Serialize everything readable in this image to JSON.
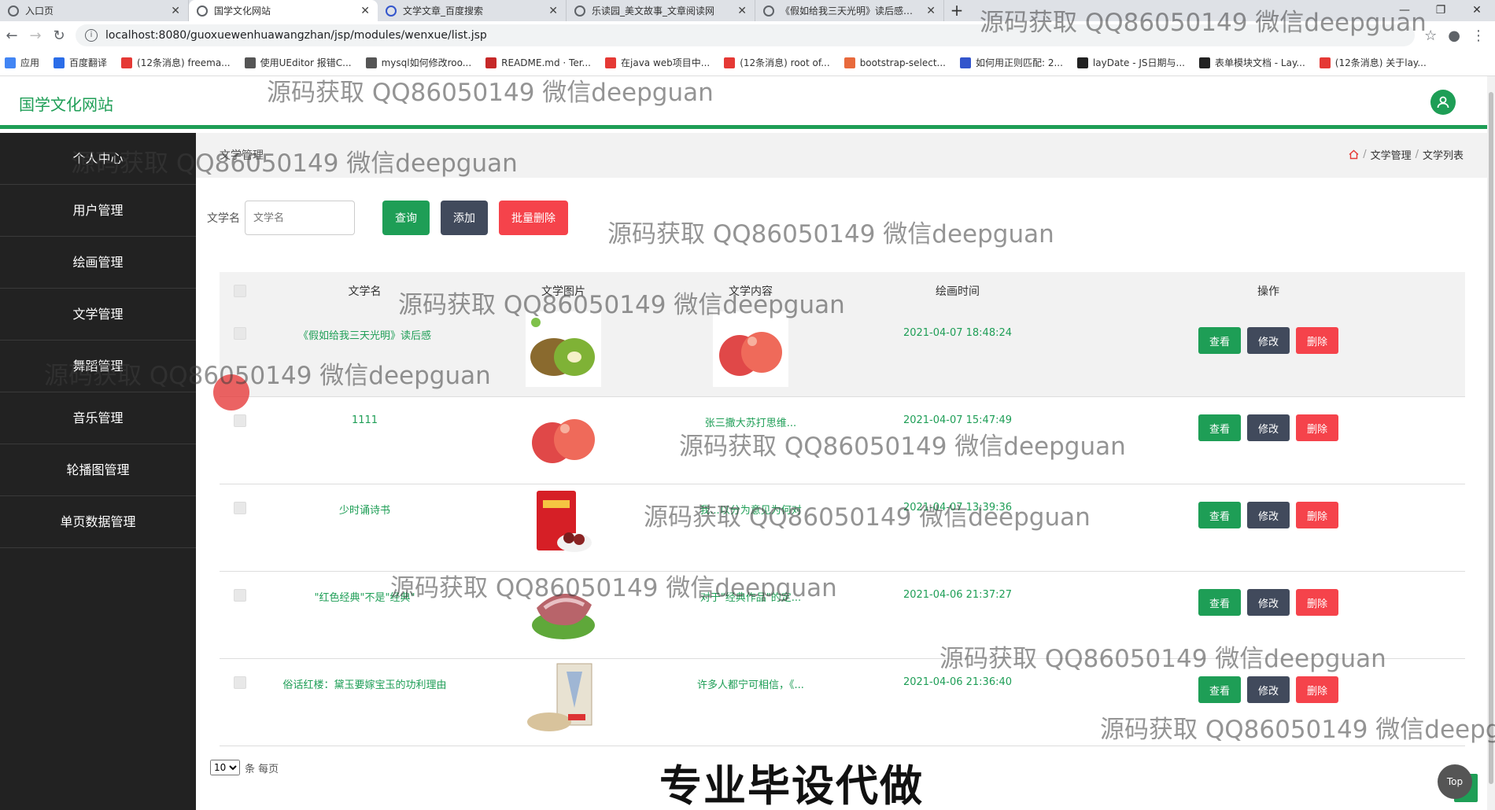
{
  "browser": {
    "tabs": [
      {
        "title": "入口页",
        "active": false
      },
      {
        "title": "国学文化网站",
        "active": true
      },
      {
        "title": "文学文章_百度搜索",
        "active": false
      },
      {
        "title": "乐读园_美文故事_文章阅读网",
        "active": false
      },
      {
        "title": "《假如给我三天光明》读后感作文",
        "active": false
      }
    ],
    "new_tab": "+",
    "url": "localhost:8080/guoxuewenhuawangzhan/jsp/modules/wenxue/list.jsp",
    "bookmarks": [
      {
        "label": "应用",
        "color": "#4285f4"
      },
      {
        "label": "百度翻译",
        "color": "#2b6de8"
      },
      {
        "label": "(12条消息) freema...",
        "color": "#e53935"
      },
      {
        "label": "使用UEditor 报错C...",
        "color": "#555555"
      },
      {
        "label": "mysql如何修改roo...",
        "color": "#555555"
      },
      {
        "label": "README.md · Ter...",
        "color": "#c62828"
      },
      {
        "label": "在java web项目中...",
        "color": "#e53935"
      },
      {
        "label": "(12条消息) root of...",
        "color": "#e53935"
      },
      {
        "label": "bootstrap-select...",
        "color": "#e86a3c"
      },
      {
        "label": "如何用正则匹配: 2...",
        "color": "#3355cc"
      },
      {
        "label": "layDate - JS日期与...",
        "color": "#222222"
      },
      {
        "label": "表单模块文档 - Lay...",
        "color": "#222222"
      },
      {
        "label": "(12条消息) 关于lay...",
        "color": "#e53935"
      }
    ]
  },
  "app": {
    "title": "国学文化网站",
    "accent": "#1e9e56"
  },
  "sidebar": {
    "items": [
      "个人中心",
      "用户管理",
      "绘画管理",
      "文学管理",
      "舞蹈管理",
      "音乐管理",
      "轮播图管理",
      "单页数据管理"
    ]
  },
  "breadcrumb": {
    "left": "文学管理",
    "items": [
      "文学管理",
      "文学列表"
    ]
  },
  "search": {
    "label": "文学名",
    "placeholder": "文学名",
    "query_btn": "查询",
    "add_btn": "添加",
    "batch_delete_btn": "批量删除"
  },
  "table": {
    "headers": {
      "name": "文学名",
      "image": "文学图片",
      "content": "文学内容",
      "time": "绘画时间",
      "ops": "操作"
    },
    "ops": {
      "view": "查看",
      "edit": "修改",
      "delete": "删除"
    },
    "rows": [
      {
        "name": "《假如给我三天光明》读后感",
        "image": "kiwi",
        "content": "",
        "content_image": "apple",
        "time": "2021-04-07 18:48:24"
      },
      {
        "name": "1111",
        "image": "apple",
        "content": "张三撒大苏打思维...",
        "time": "2021-04-07 15:47:49"
      },
      {
        "name": "少时诵诗书",
        "image": "dates-bag",
        "content": "我...以分为意见为何对",
        "time": "2021-04-07 13:39:36"
      },
      {
        "name": "\"红色经典\"不是\"经典\"",
        "image": "meat",
        "content": "对于\"经典作品\"的定...",
        "time": "2021-04-06 21:37:27"
      },
      {
        "name": "俗话红楼：黛玉要嫁宝玉的功利理由",
        "image": "seafood",
        "content": "许多人都宁可相信，《...",
        "time": "2021-04-06 21:36:40"
      }
    ]
  },
  "pager": {
    "page_size": "10",
    "suffix": "条 每页"
  },
  "overlay": {
    "watermark": "源码获取 QQ86050149 微信deepguan",
    "watermark_trunc": "源码获取 QQ86050149 微信deepgu",
    "promo": "专业毕设代做",
    "top": "Top"
  }
}
